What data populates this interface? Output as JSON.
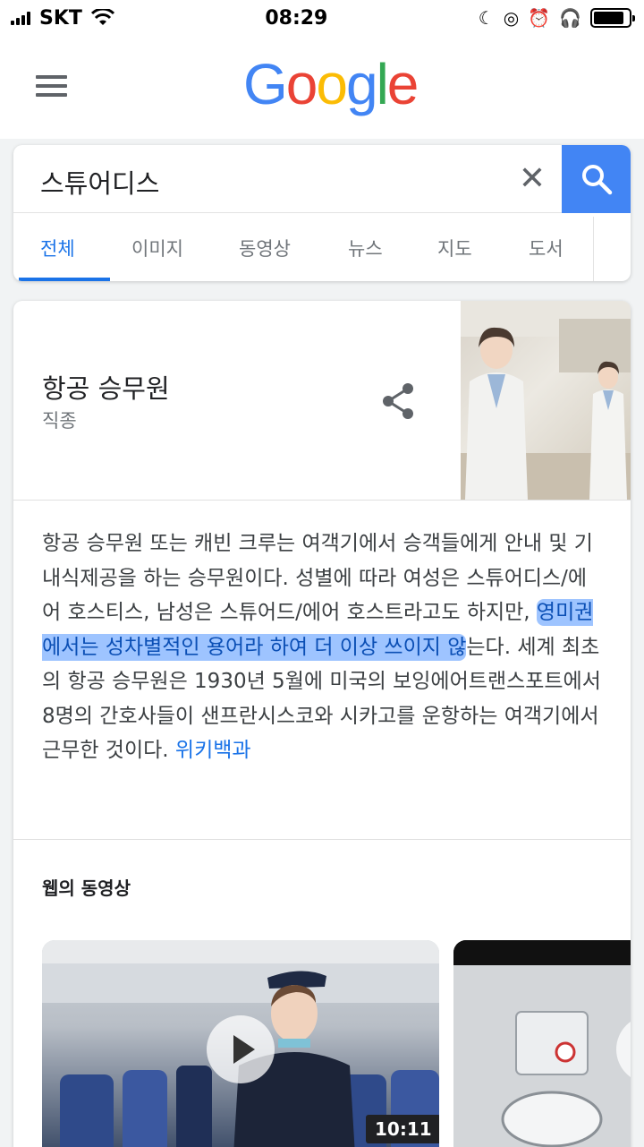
{
  "status_bar": {
    "carrier": "SKT",
    "time": "08:29"
  },
  "header": {
    "logo_text": "Google",
    "logo_letters": [
      "G",
      "o",
      "o",
      "g",
      "l",
      "e"
    ]
  },
  "search": {
    "query": "스튜어디스",
    "clear_symbol": "✕"
  },
  "tabs": [
    {
      "label": "전체",
      "active": true
    },
    {
      "label": "이미지",
      "active": false
    },
    {
      "label": "동영상",
      "active": false
    },
    {
      "label": "뉴스",
      "active": false
    },
    {
      "label": "지도",
      "active": false
    },
    {
      "label": "도서",
      "active": false
    }
  ],
  "knowledge": {
    "title": "항공 승무원",
    "subtitle": "직종",
    "description_pre": "항공 승무원 또는 캐빈 크루는 여객기에서 승객들에게 안내 및 기내식제공을 하는 승무원이다. 성별에 따라 여성은 스튜어디스/에어 호스티스, 남성은 스튜어드/에어 호스트라고도 하지만, ",
    "description_highlight": "영미권에서는 성차별적인 용어라 하여 더 이상 쓰이지 않",
    "description_post": "는다. 세계 최초의 항공 승무원은 1930년 5월에 미국의 보잉에어트랜스포트에서 8명의 간호사들이 샌프란시스코와 시카고를 운항하는 여객기에서 근무한 것이다. ",
    "source_link": "위키백과"
  },
  "videos": {
    "heading": "웹의 동영상",
    "items": [
      {
        "duration": "10:11"
      },
      {
        "duration": ""
      }
    ]
  },
  "colors": {
    "accent": "#1a73e8",
    "search_button": "#4285f4",
    "highlight": "#4f94ff"
  },
  "icons": [
    "hamburger-icon",
    "close-icon",
    "search-icon",
    "share-icon",
    "play-icon",
    "wifi-icon",
    "battery-icon"
  ]
}
